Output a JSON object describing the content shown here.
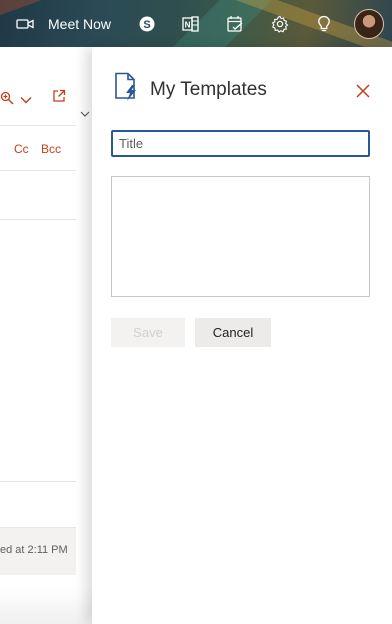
{
  "topbar": {
    "meet_now_label": "Meet Now",
    "icons": [
      "video-camera-icon",
      "skype-icon",
      "onenote-icon",
      "todo-icon",
      "gear-icon",
      "lightbulb-icon",
      "avatar"
    ]
  },
  "background": {
    "cc_label": "Cc",
    "bcc_label": "Bcc",
    "saved_text": "ed at 2:11 PM"
  },
  "panel": {
    "title": "My Templates",
    "title_input": {
      "placeholder": "Title",
      "value": ""
    },
    "body_value": "",
    "save_label": "Save",
    "cancel_label": "Cancel"
  },
  "colors": {
    "accent": "#c43e1c",
    "focus_border": "#2b5797",
    "title_text": "#323130"
  }
}
